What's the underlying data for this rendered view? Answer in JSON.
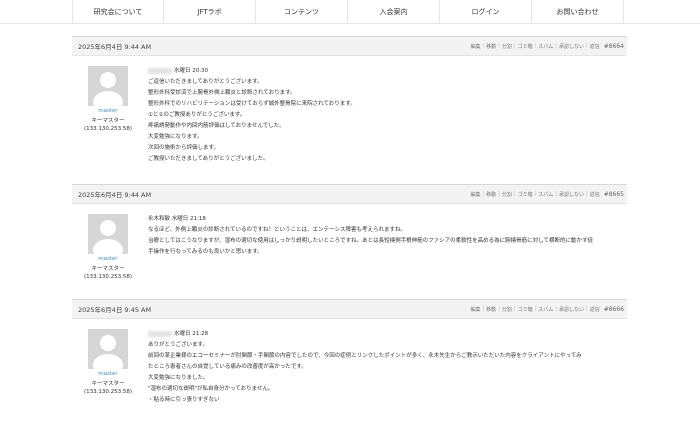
{
  "nav": {
    "items": [
      "研究会について",
      "JFTラボ",
      "コンテンツ",
      "入会案内",
      "ログイン",
      "お問い合わせ"
    ]
  },
  "actions": [
    "編集",
    "移動",
    "分割",
    "ゴミ箱",
    "スパム",
    "承認しない",
    "返信"
  ],
  "posts": [
    {
      "date": "2025年6月4日 9:44 AM",
      "number": "#8664",
      "author": {
        "name": "master",
        "role": "キーマスター",
        "ip": "(133.130.253.58)"
      },
      "header_line": "水曜日 20:30",
      "name_blurred": true,
      "lines": [
        "ご返信いただきましてありがとうございます。",
        "整形外科受診済で上腕骨外側上顆炎と診断されております。",
        "整形外科でのリハビリテーションは受けておらず城外整骨院に来院されております。",
        "①と②のご教授ありがとうございます。",
        "疼痛誘発動作や内回内筋評価はしておりませんでした。",
        "大変勉強になります。",
        "次回の施術から評価します。",
        "ご教授いただきましてありがとうございました。"
      ]
    },
    {
      "date": "2025年6月4日 9:44 AM",
      "number": "#8665",
      "author": {
        "name": "master",
        "role": "キーマスター",
        "ip": "(133.130.253.58)"
      },
      "header_line": "永木和敏 水曜日 21:18",
      "name_blurred": false,
      "lines": [
        "なるほど、外側上顆炎の診断されているのですね！ということは、エンテーシス障害も考えられますね。",
        "治療としてはこうなりますが、湿布の適切な使用はしっかり説明したいところですね。あとは長短橈側手根伸筋のファシアの柔軟性を高める為に腕橈骨筋に対して横断的に動かす徒",
        "手操作を行なってみるのも良いかと思います。"
      ]
    },
    {
      "date": "2025年6月4日 9:45 AM",
      "number": "#8666",
      "author": {
        "name": "master",
        "role": "キーマスター",
        "ip": "(133.130.253.58)"
      },
      "header_line": "水曜日 21:28",
      "name_blurred": true,
      "lines": [
        "ありがとうございます。",
        "前回の某企業様のエコーセミナーが肘関節・手関節の内容でしたので、今回の症例とリンクしたポイントが多く、永木先生からご教示いただいた内容をクライアントにやってみ",
        "たところ患者さんの自覚している痛みの改善度が高かったです。",
        "大変勉強になりました。",
        "\"湿布の適切な説明\"が私自身分かっておりません。",
        "・貼る時に引っ張りすぎない"
      ]
    }
  ]
}
